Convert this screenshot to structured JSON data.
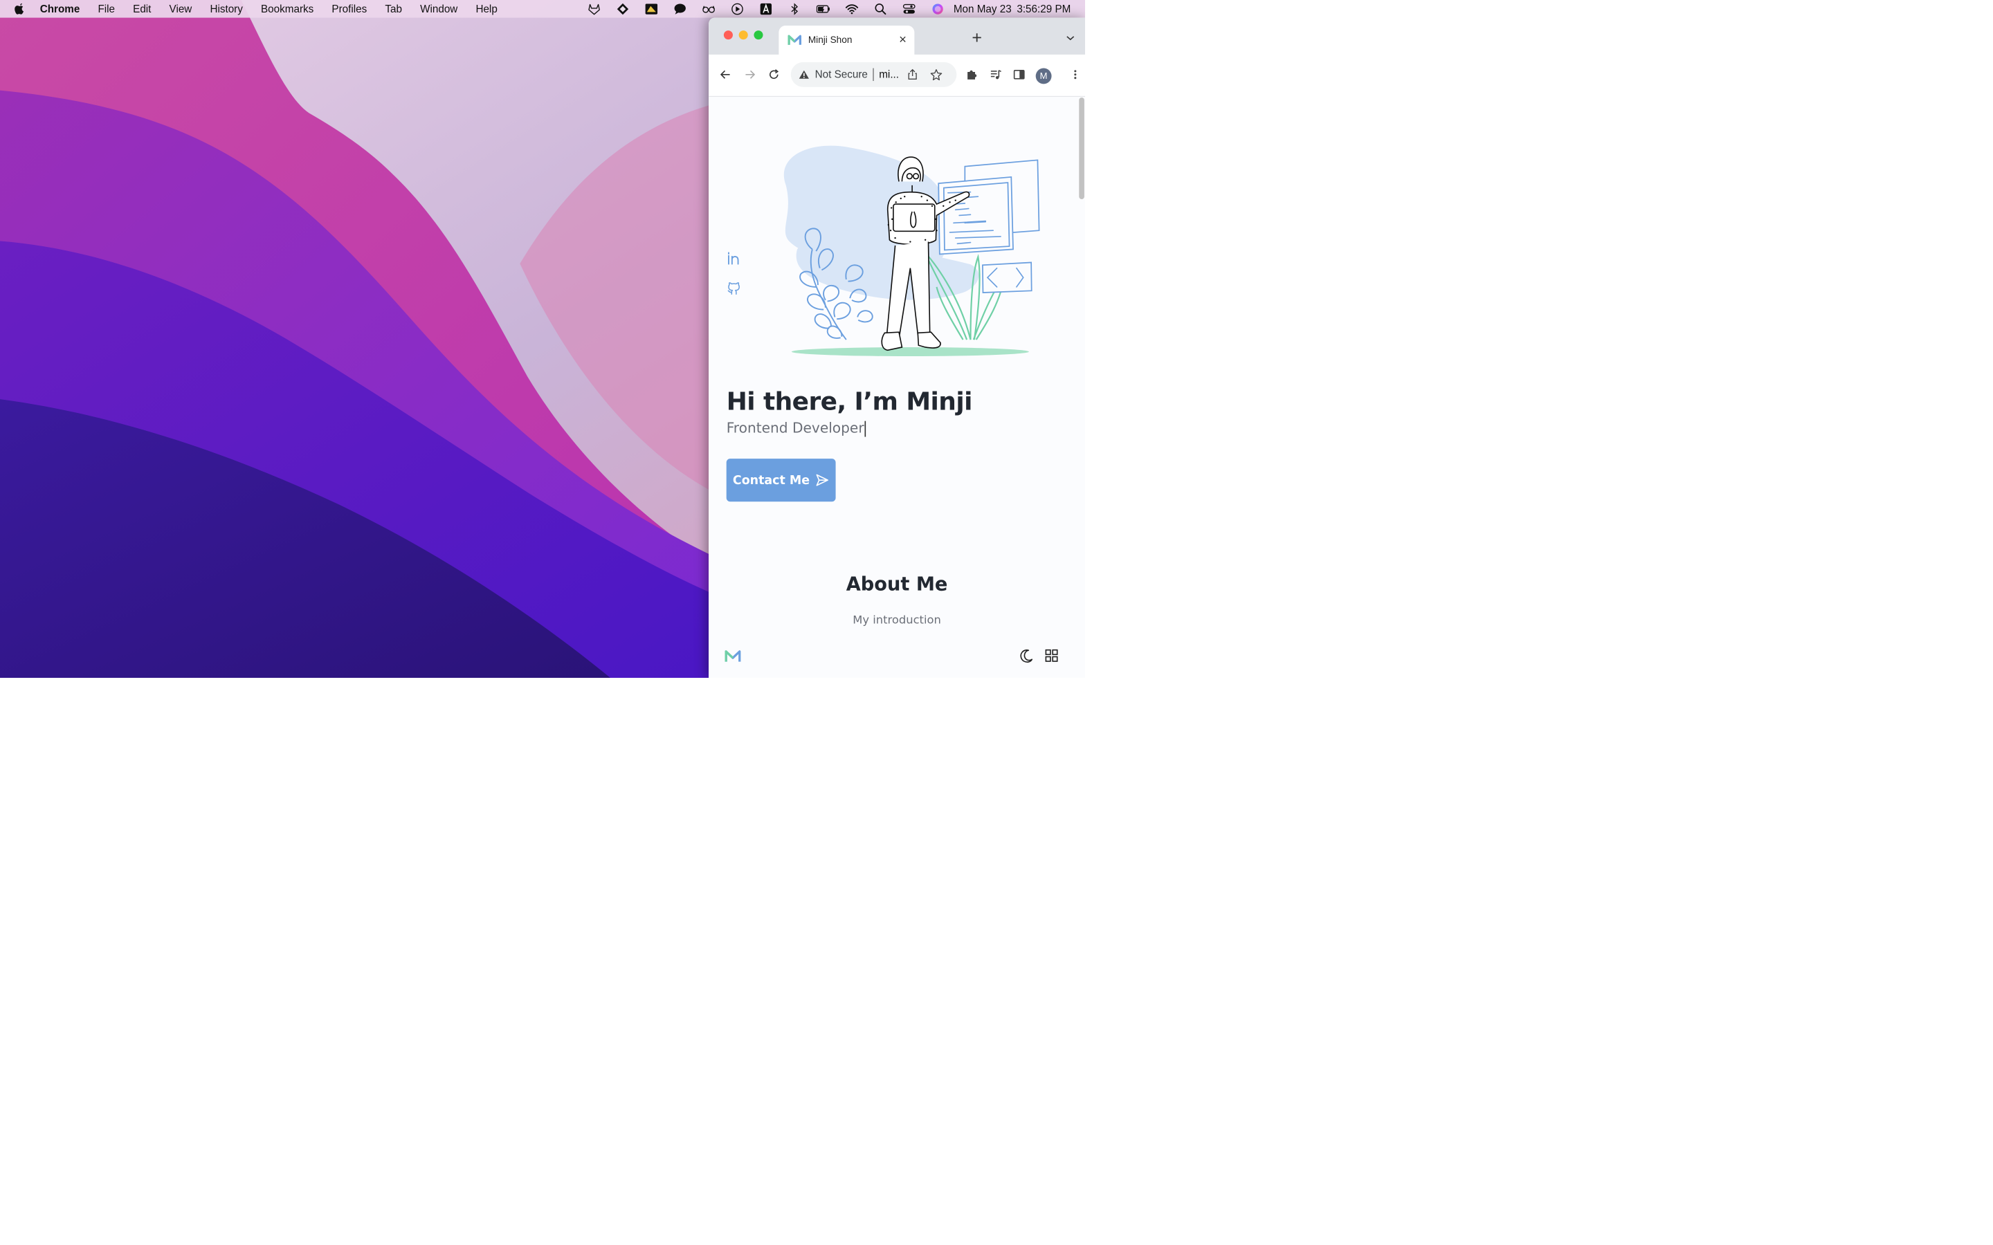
{
  "menubar": {
    "app": "Chrome",
    "items": [
      "File",
      "Edit",
      "View",
      "History",
      "Bookmarks",
      "Profiles",
      "Tab",
      "Window",
      "Help"
    ],
    "date": "Mon May 23",
    "time": "3:56:29 PM"
  },
  "browser": {
    "tab_title": "Minji Shon",
    "security": "Not Secure",
    "url": "mi...",
    "profile_initial": "M"
  },
  "page": {
    "hero_title": "Hi there, I’m Minji",
    "hero_subtitle": "Frontend Developer",
    "contact_label": "Contact Me",
    "about_title": "About Me",
    "about_subtitle": "My introduction"
  },
  "colors": {
    "accent": "#6b9fdf",
    "green": "#6fd0a6",
    "heading": "#222831"
  }
}
